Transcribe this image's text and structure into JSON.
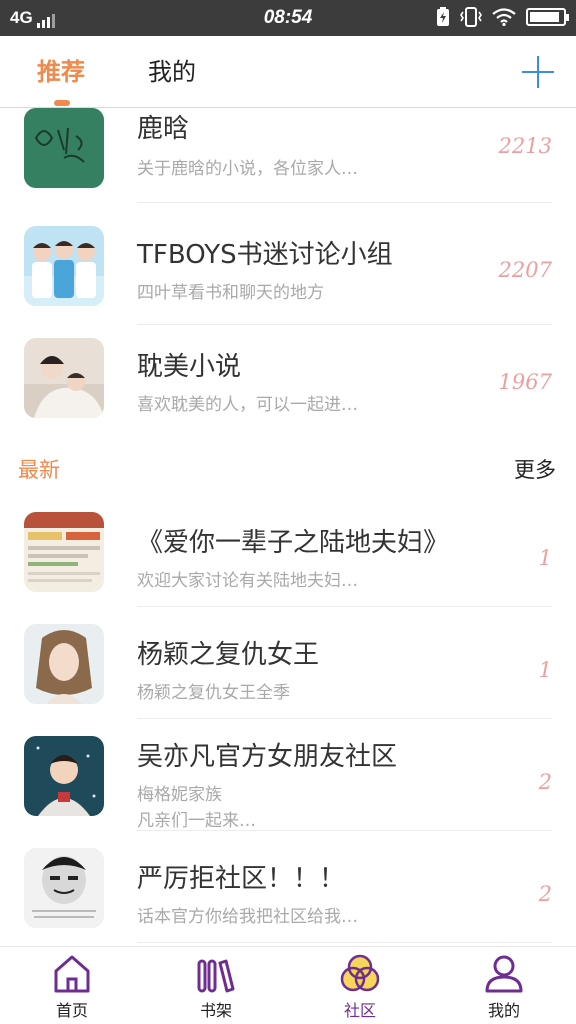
{
  "status_bar": {
    "network": "4G",
    "time": "08:54"
  },
  "header": {
    "tabs": [
      {
        "label": "推荐",
        "active": true
      },
      {
        "label": "我的",
        "active": false
      }
    ],
    "add_icon": "plus-icon"
  },
  "recommended": [
    {
      "title": "鹿晗",
      "subtitle": "关于鹿晗的小说，各位家人…",
      "count": "2213"
    },
    {
      "title": "TFBOYS书迷讨论小组",
      "subtitle": "四叶草看书和聊天的地方",
      "count": "2207"
    },
    {
      "title": "耽美小说",
      "subtitle": "喜欢耽美的人，可以一起进…",
      "count": "1967"
    }
  ],
  "latest_section": {
    "title": "最新",
    "more": "更多"
  },
  "latest": [
    {
      "title": "《爱你一辈子之陆地夫妇》",
      "subtitle": "欢迎大家讨论有关陆地夫妇…",
      "subtitle2": "",
      "count": "1"
    },
    {
      "title": "杨颖之复仇女王",
      "subtitle": "杨颖之复仇女王全季",
      "subtitle2": "",
      "count": "1"
    },
    {
      "title": "吴亦凡官方女朋友社区",
      "subtitle": "梅格妮家族",
      "subtitle2": "凡亲们一起来…",
      "count": "2"
    },
    {
      "title": "严厉拒社区！！！",
      "subtitle": "话本官方你给我把社区给我…",
      "subtitle2": "",
      "count": "2"
    }
  ],
  "bottom_nav": [
    {
      "label": "首页",
      "icon": "home-icon",
      "active": false
    },
    {
      "label": "书架",
      "icon": "bookshelf-icon",
      "active": false
    },
    {
      "label": "社区",
      "icon": "community-icon",
      "active": true
    },
    {
      "label": "我的",
      "icon": "profile-icon",
      "active": false
    }
  ],
  "colors": {
    "accent": "#ee8a4e",
    "nav_active": "#6e2d91",
    "count": "#eaa0a0",
    "add": "#3a8fe0"
  }
}
